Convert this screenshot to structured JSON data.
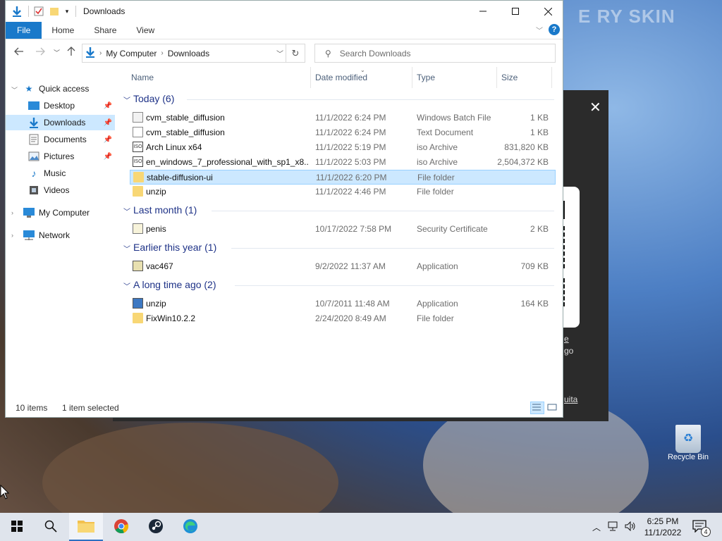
{
  "desktop": {
    "wallpaper_text": "E RY SKIN",
    "recycle_bin_label": "Recycle Bin"
  },
  "background_window": {
    "close_glyph": "✕",
    "link1": "e",
    "link2": "go",
    "link3": "uita"
  },
  "explorer": {
    "title": "Downloads",
    "ribbon_tabs": [
      "File",
      "Home",
      "Share",
      "View"
    ],
    "help": "?",
    "breadcrumb": [
      "My Computer",
      "Downloads"
    ],
    "search_placeholder": "Search Downloads",
    "columns": [
      "Name",
      "Date modified",
      "Type",
      "Size"
    ],
    "nav_pane": {
      "quick_access": "Quick access",
      "items": [
        "Desktop",
        "Downloads",
        "Documents",
        "Pictures",
        "Music",
        "Videos"
      ],
      "my_computer": "My Computer",
      "network": "Network"
    },
    "groups": [
      {
        "label": "Today (6)",
        "rows": [
          {
            "name": "cvm_stable_diffusion",
            "date": "11/1/2022 6:24 PM",
            "type": "Windows Batch File",
            "size": "1 KB",
            "icon": "batch-file-icon"
          },
          {
            "name": "cvm_stable_diffusion",
            "date": "11/1/2022 6:24 PM",
            "type": "Text Document",
            "size": "1 KB",
            "icon": "text-file-icon"
          },
          {
            "name": "Arch Linux x64",
            "date": "11/1/2022 5:19 PM",
            "type": "iso Archive",
            "size": "831,820 KB",
            "icon": "iso-file-icon"
          },
          {
            "name": "en_windows_7_professional_with_sp1_x8...",
            "date": "11/1/2022 5:03 PM",
            "type": "iso Archive",
            "size": "2,504,372 KB",
            "icon": "iso-file-icon"
          },
          {
            "name": "stable-diffusion-ui",
            "date": "11/1/2022 6:20 PM",
            "type": "File folder",
            "size": "",
            "icon": "folder-icon"
          },
          {
            "name": "unzip",
            "date": "11/1/2022 4:46 PM",
            "type": "File folder",
            "size": "",
            "icon": "folder-icon"
          }
        ]
      },
      {
        "label": "Last month (1)",
        "rows": [
          {
            "name": "penis",
            "date": "10/17/2022 7:58 PM",
            "type": "Security Certificate",
            "size": "2 KB",
            "icon": "certificate-icon"
          }
        ]
      },
      {
        "label": "Earlier this year (1)",
        "rows": [
          {
            "name": "vac467",
            "date": "9/2/2022 11:37 AM",
            "type": "Application",
            "size": "709 KB",
            "icon": "application-icon"
          }
        ]
      },
      {
        "label": "A long time ago (2)",
        "rows": [
          {
            "name": "unzip",
            "date": "10/7/2011 11:48 AM",
            "type": "Application",
            "size": "164 KB",
            "icon": "application-icon"
          },
          {
            "name": "FixWin10.2.2",
            "date": "2/24/2020 8:49 AM",
            "type": "File folder",
            "size": "",
            "icon": "folder-icon"
          }
        ]
      }
    ],
    "status": {
      "item_count": "10 items",
      "selection": "1 item selected"
    }
  },
  "taskbar": {
    "clock_time": "6:25 PM",
    "clock_date": "11/1/2022",
    "notification_count": "4",
    "apps": [
      "start-icon",
      "search-icon",
      "file-explorer-icon",
      "chrome-icon",
      "steam-icon",
      "edge-icon"
    ]
  },
  "colors": {
    "accent": "#1979ca",
    "selection": "#cce8ff",
    "group_header": "#1e3287"
  }
}
